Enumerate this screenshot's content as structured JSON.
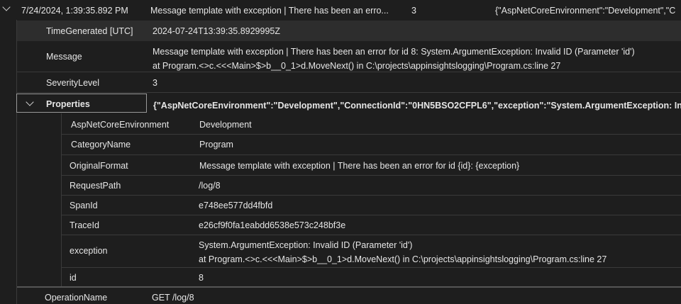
{
  "header": {
    "timestamp": "7/24/2024, 1:39:35.892 PM",
    "message": "Message template with exception | There has been an erro...",
    "severity": "3",
    "properties": "{\"AspNetCoreEnvironment\":\"Development\",\"C"
  },
  "fields": {
    "time_generated": {
      "label": "TimeGenerated [UTC]",
      "value": "2024-07-24T13:39:35.8929995Z"
    },
    "message": {
      "label": "Message",
      "value_line1": "Message template with exception | There has been an error for id 8: System.ArgumentException: Invalid ID (Parameter 'id')",
      "value_line2": "at Program.<>c.<<<Main>$>b__0_1>d.MoveNext() in C:\\projects\\appinsightslogging\\Program.cs:line 27"
    },
    "severity_level": {
      "label": "SeverityLevel",
      "value": "3"
    },
    "properties": {
      "label": "Properties",
      "value": "{\"AspNetCoreEnvironment\":\"Development\",\"ConnectionId\":\"0HN5BSO2CFPL6\",\"exception\":\"System.ArgumentException: Invalid ID"
    },
    "operation_name": {
      "label": "OperationName",
      "value": "GET /log/8"
    }
  },
  "properties_rows": {
    "env": {
      "key": "AspNetCoreEnvironment",
      "value": "Development"
    },
    "category": {
      "key": "CategoryName",
      "value": "Program"
    },
    "original_format": {
      "key": "OriginalFormat",
      "value": "Message template with exception | There has been an error for id {id}: {exception}"
    },
    "request_path": {
      "key": "RequestPath",
      "value": "/log/8"
    },
    "span_id": {
      "key": "SpanId",
      "value": "e748ee577dd4fbfd"
    },
    "trace_id": {
      "key": "TraceId",
      "value": "e26cf9f0fa1eabdd6538e573c248bf3e"
    },
    "exception": {
      "key": "exception",
      "value_line1": "System.ArgumentException: Invalid ID (Parameter 'id')",
      "value_line2": "at Program.<>c.<<<Main>$>b__0_1>d.MoveNext() in C:\\projects\\appinsightslogging\\Program.cs:line 27"
    },
    "id": {
      "key": "id",
      "value": "8"
    }
  },
  "icons": {
    "expand_header": "chevron-down-icon",
    "expand_properties": "chevron-down-icon"
  }
}
